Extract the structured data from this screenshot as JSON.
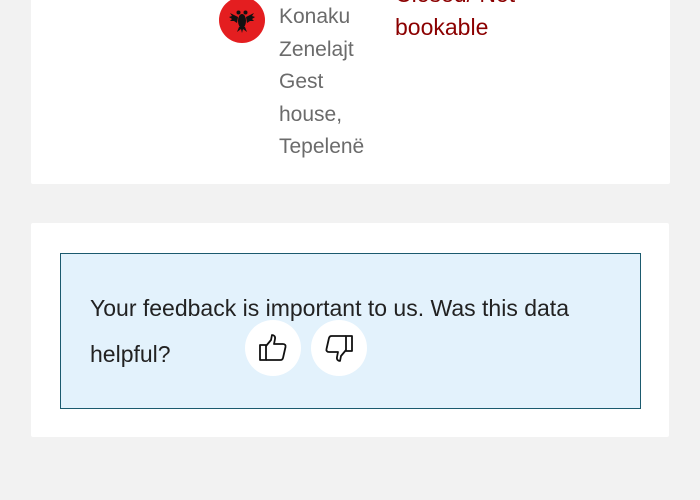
{
  "result_card": {
    "stay_name": "Konaku\nZenelajt\nGest\nhouse,\nTepelenë",
    "status": "Closed/ Not\nbookable",
    "flag_icon": "albania-flag-icon",
    "flag_color": "#e41e20",
    "status_color": "#8b0000"
  },
  "feedback": {
    "prompt": "Your feedback is important to us. Was this data helpful?",
    "thumbs_up_icon": "thumbs-up-icon",
    "thumbs_down_icon": "thumbs-down-icon",
    "box_color": "#e3f2fc",
    "border_color": "#1b5a6e"
  }
}
